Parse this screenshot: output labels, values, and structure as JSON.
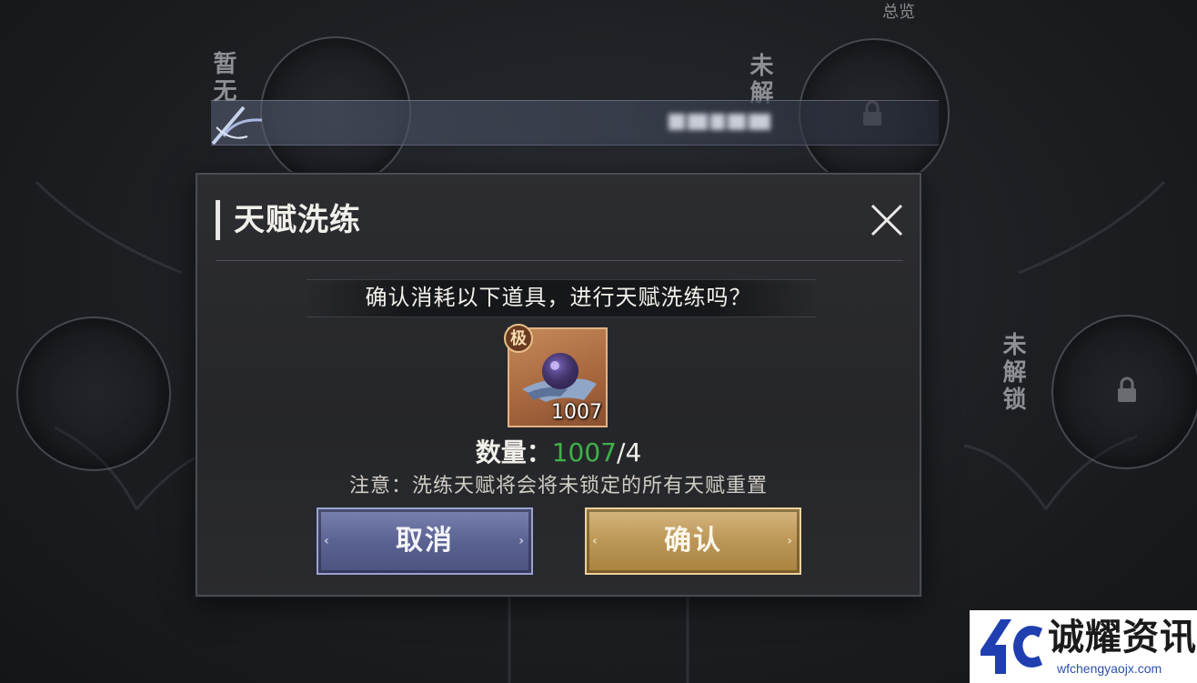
{
  "background": {
    "left_slot_label": "暂无",
    "right_top_slot_label": "未解",
    "right_mid_slot_label": "未解锁",
    "corner_text": "总览"
  },
  "dialog": {
    "title": "天赋洗练",
    "prompt": "确认消耗以下道具，进行天赋洗练吗？",
    "item": {
      "grade_badge": "极",
      "count": "1007",
      "icon": "talent-orb-icon"
    },
    "quantity": {
      "label": "数量：",
      "have": "1007",
      "separator": "/",
      "need": "4"
    },
    "note": "注意：洗练天赋将会将未锁定的所有天赋重置",
    "buttons": {
      "cancel": "取消",
      "confirm": "确认"
    },
    "colors": {
      "have_amount": "#3fb24a",
      "cancel_button": "#5b6392",
      "confirm_button": "#bc9656"
    }
  },
  "watermark": {
    "title": "诚耀资讯",
    "url": "wfchengyaojx.com"
  }
}
